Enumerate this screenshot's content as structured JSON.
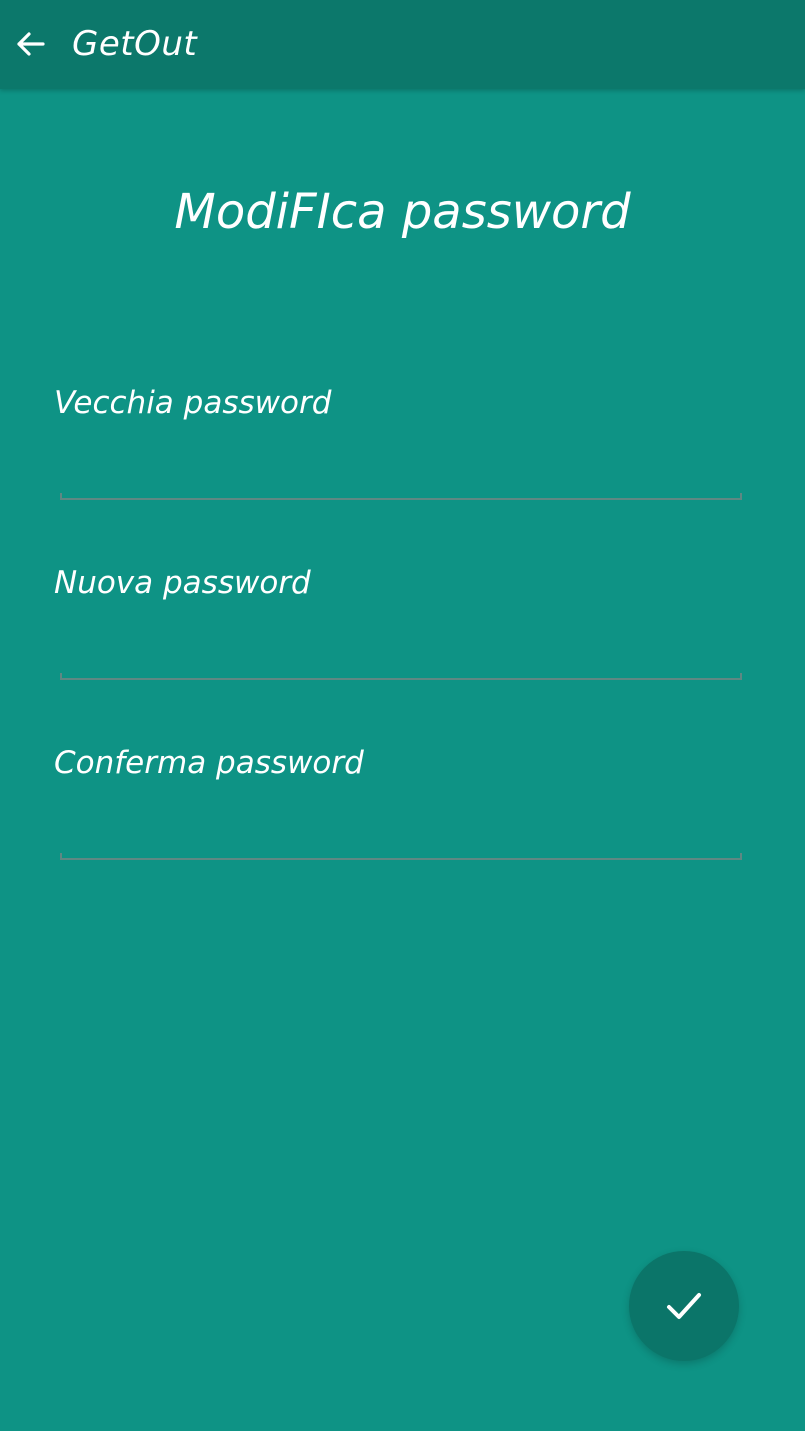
{
  "app_bar": {
    "title": "GetOut",
    "back_icon": "arrow-back-icon"
  },
  "page": {
    "title": "ModiFIca password"
  },
  "form": {
    "fields": [
      {
        "label": "Vecchia password",
        "value": "",
        "type": "password"
      },
      {
        "label": "Nuova password",
        "value": "",
        "type": "password"
      },
      {
        "label": "Conferma password",
        "value": "",
        "type": "password"
      }
    ]
  },
  "fab": {
    "icon": "check-icon"
  },
  "colors": {
    "background": "#0e9385",
    "app_bar": "#0c786b",
    "fab": "#0b7569",
    "text": "#ffffff",
    "underline": "#5f8883"
  }
}
